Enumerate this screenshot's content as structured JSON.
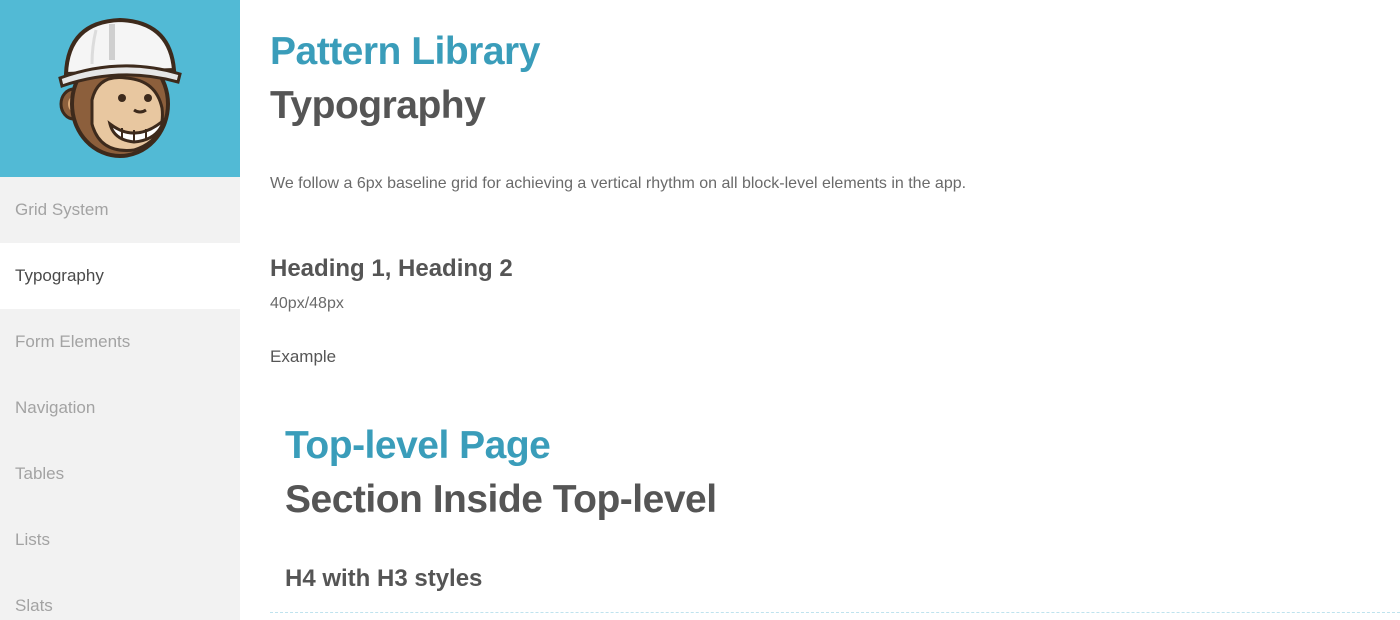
{
  "sidebar": {
    "logo_icon": "freddie-monkey-hardhat-logo",
    "items": [
      {
        "label": "Grid System",
        "active": false
      },
      {
        "label": "Typography",
        "active": true
      },
      {
        "label": "Form Elements",
        "active": false
      },
      {
        "label": "Navigation",
        "active": false
      },
      {
        "label": "Tables",
        "active": false
      },
      {
        "label": "Lists",
        "active": false
      },
      {
        "label": "Slats",
        "active": false
      }
    ]
  },
  "main": {
    "title": "Pattern Library",
    "subtitle": "Typography",
    "intro": "We follow a 6px baseline grid for achieving a vertical rhythm on all block-level elements in the app.",
    "heading_spec": "Heading 1, Heading 2",
    "size_spec": "40px/48px",
    "example_label": "Example",
    "example": {
      "h1": "Top-level Page",
      "h2": "Section Inside Top-level",
      "h4": "H4 with H3 styles"
    }
  },
  "colors": {
    "sidebar_logo_bg": "#52bad5",
    "sidebar_bg": "#f2f2f2",
    "accent": "#3a9dba",
    "heading": "#555555",
    "nav_inactive": "#a3a3a3"
  }
}
